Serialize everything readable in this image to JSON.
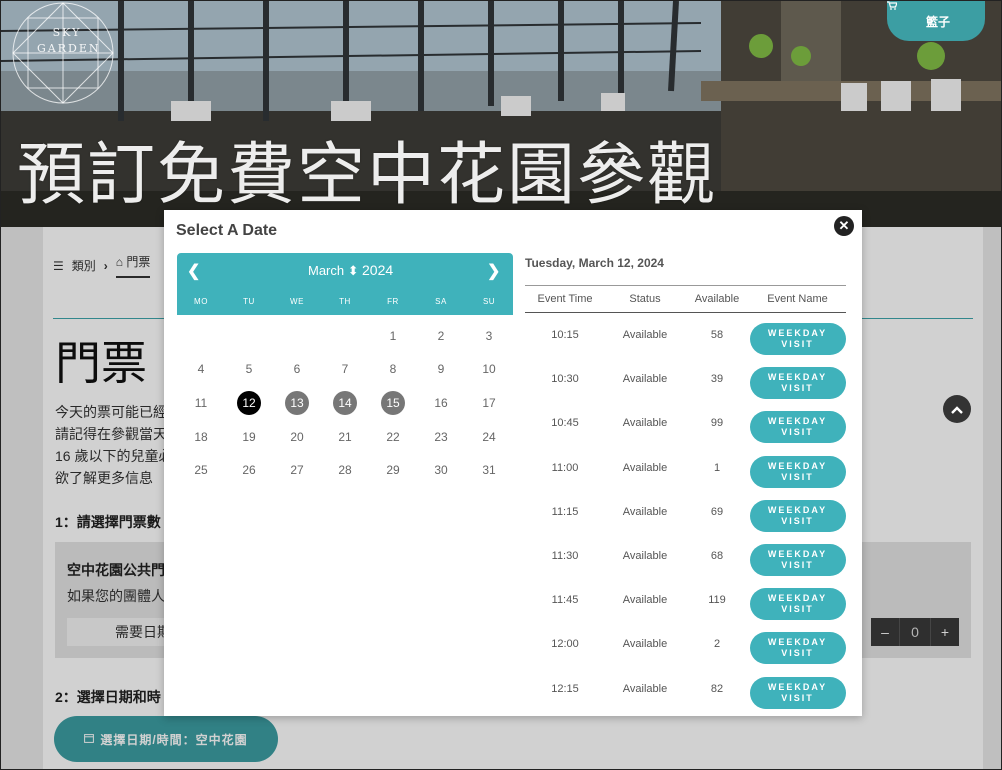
{
  "hero": {
    "logo_line1": "SKY",
    "logo_line2": "GARDEN",
    "title": "預訂免費空中花園參觀",
    "cart_label": "籃子"
  },
  "page": {
    "breadcrumb": {
      "item1": "類別",
      "item2": "門票"
    },
    "heading": "門票",
    "intro_lines": [
      "今天的票可能已經",
      "請記得在參觀當天",
      "16 歲以下的兒童必",
      "欲了解更多信息"
    ],
    "step1_label": "1：請選擇門票數",
    "ticket": {
      "name": "空中花園公共門",
      "note": "如果您的團體人",
      "requirement": "需要日期",
      "quantity": "0"
    },
    "step2_label": "2：選擇日期和時",
    "select_date_button": "選擇日期/時間：空中花園"
  },
  "modal": {
    "title": "Select A Date",
    "calendar": {
      "month": "March",
      "year": "2024",
      "weekdays": [
        "MO",
        "TU",
        "WE",
        "TH",
        "FR",
        "SA",
        "SU"
      ],
      "leading_blanks": 4,
      "days_in_month": 31,
      "selected_day": 12,
      "available_days": [
        13,
        14,
        15
      ]
    },
    "selected_date_label": "Tuesday, March 12, 2024",
    "columns": {
      "time": "Event Time",
      "status": "Status",
      "available": "Available",
      "event": "Event Name"
    },
    "slots": [
      {
        "time": "10:15",
        "status": "Available",
        "available": "58",
        "event": "WEEKDAY VISIT"
      },
      {
        "time": "10:30",
        "status": "Available",
        "available": "39",
        "event": "WEEKDAY VISIT"
      },
      {
        "time": "10:45",
        "status": "Available",
        "available": "99",
        "event": "WEEKDAY VISIT"
      },
      {
        "time": "11:00",
        "status": "Available",
        "available": "1",
        "event": "WEEKDAY VISIT"
      },
      {
        "time": "11:15",
        "status": "Available",
        "available": "69",
        "event": "WEEKDAY VISIT"
      },
      {
        "time": "11:30",
        "status": "Available",
        "available": "68",
        "event": "WEEKDAY VISIT"
      },
      {
        "time": "11:45",
        "status": "Available",
        "available": "119",
        "event": "WEEKDAY VISIT"
      },
      {
        "time": "12:00",
        "status": "Available",
        "available": "2",
        "event": "WEEKDAY VISIT"
      },
      {
        "time": "12:15",
        "status": "Available",
        "available": "82",
        "event": "WEEKDAY VISIT"
      }
    ]
  },
  "colors": {
    "accent": "#3fb2bb",
    "brand_button": "#3c9ea3",
    "selected_day": "#000000",
    "available_day": "#777777"
  },
  "icons": {
    "cart": "cart-icon",
    "close": "close-icon",
    "prev": "chevron-left-icon",
    "next": "chevron-right-icon",
    "scroll_top": "chevron-up-icon",
    "list": "list-icon",
    "ticket": "tag-icon",
    "calendar": "calendar-icon"
  }
}
